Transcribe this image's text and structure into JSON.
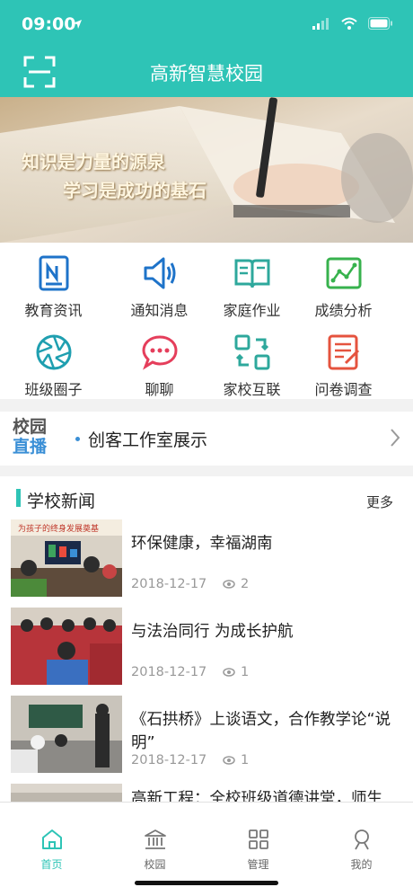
{
  "status_bar": {
    "time": "09:00"
  },
  "header": {
    "title": "高新智慧校园"
  },
  "banner": {
    "line1": "知识是力量的源泉",
    "line2": "学习是成功的基石"
  },
  "menu": [
    {
      "label": "教育资讯",
      "icon": "news-icon",
      "color": "#1e73c9"
    },
    {
      "label": "通知消息",
      "icon": "speaker-icon",
      "color": "#1e73c9"
    },
    {
      "label": "家庭作业",
      "icon": "book-icon",
      "color": "#2ea89c"
    },
    {
      "label": "成绩分析",
      "icon": "chart-icon",
      "color": "#37b24d"
    },
    {
      "label": "班级圈子",
      "icon": "aperture-icon",
      "color": "#1f9fb0"
    },
    {
      "label": "聊聊",
      "icon": "chat-icon",
      "color": "#e53e5b"
    },
    {
      "label": "家校互联",
      "icon": "connect-icon",
      "color": "#2ea89c"
    },
    {
      "label": "问卷调查",
      "icon": "survey-icon",
      "color": "#e5533e"
    }
  ],
  "live": {
    "badge_top": "校园",
    "badge_bottom": "直播",
    "text": "创客工作室展示"
  },
  "news": {
    "title": "学校新闻",
    "more": "更多",
    "items": [
      {
        "title": "环保健康，幸福湖南",
        "date": "2018-12-17",
        "views": "2"
      },
      {
        "title": "与法治同行 为成长护航",
        "date": "2018-12-17",
        "views": "1"
      },
      {
        "title": "《石拱桥》上谈语文，合作教学论“说明”",
        "date": "2018-12-17",
        "views": "1"
      },
      {
        "title": "高新工程：全校班级道德讲堂，师生",
        "date": "",
        "views": ""
      }
    ],
    "thumb_caption": "为孩子的终身发展奠基"
  },
  "tabbar": [
    {
      "label": "首页",
      "icon": "home-icon",
      "active": true
    },
    {
      "label": "校园",
      "icon": "campus-icon",
      "active": false
    },
    {
      "label": "管理",
      "icon": "grid-icon",
      "active": false
    },
    {
      "label": "我的",
      "icon": "user-icon",
      "active": false
    }
  ],
  "colors": {
    "primary": "#2ec4b6",
    "accent_blue": "#3a8fd6"
  }
}
